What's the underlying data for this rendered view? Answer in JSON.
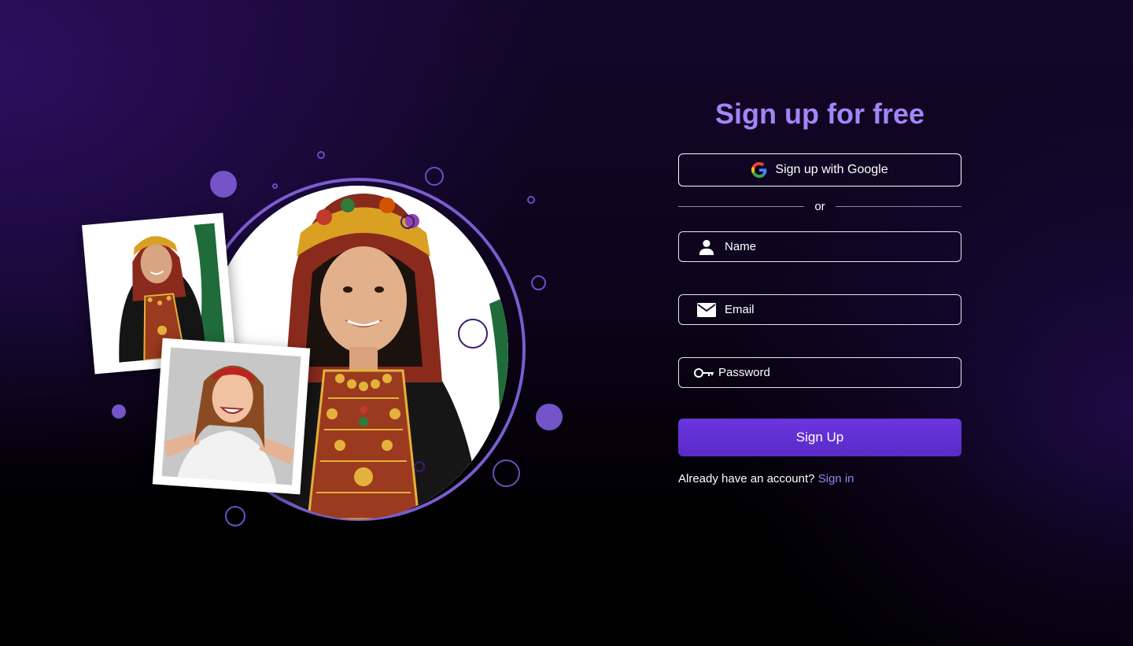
{
  "form": {
    "title": "Sign up for free",
    "google_button_label": "Sign up with Google",
    "divider_text": "or",
    "fields": {
      "name": {
        "placeholder": "Name",
        "icon": "user-icon"
      },
      "email": {
        "placeholder": "Email",
        "icon": "mail-icon"
      },
      "password": {
        "placeholder": "Password",
        "icon": "key-icon"
      }
    },
    "submit_label": "Sign Up",
    "signin_prompt": "Already have an account?",
    "signin_link": "Sign in"
  },
  "colors": {
    "accent": "#a285f6",
    "button": "#5f2fd3",
    "link": "#9b84f0",
    "background": "#0d041c"
  }
}
